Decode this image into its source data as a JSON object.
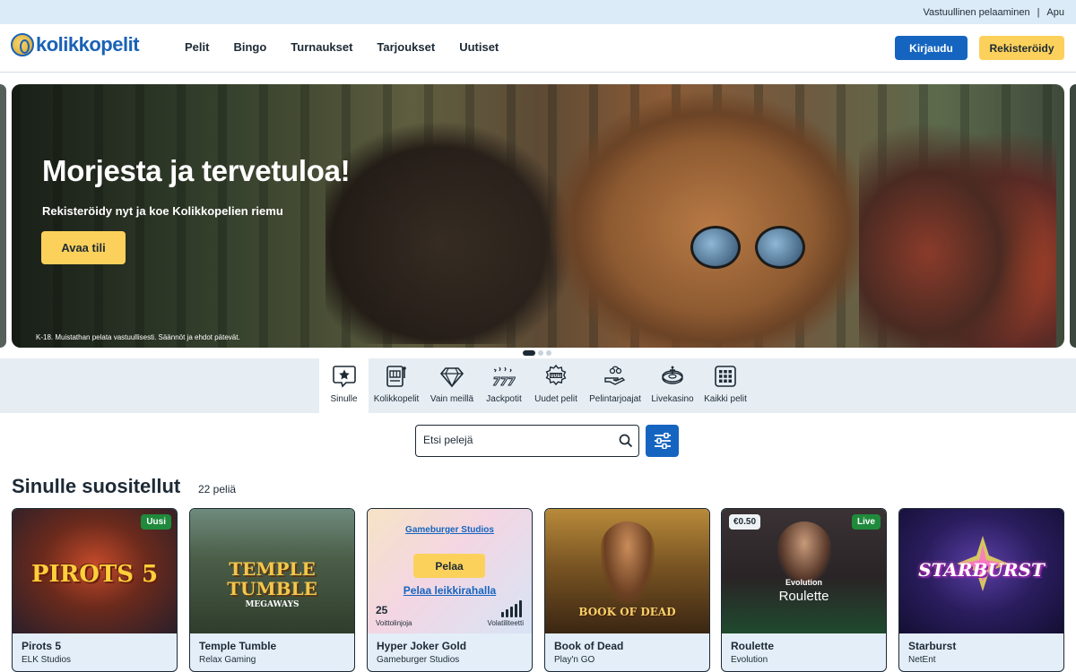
{
  "topbar": {
    "responsible": "Vastuullinen pelaaminen",
    "separator": "|",
    "help": "Apu"
  },
  "header": {
    "logo_text": "kolikkopelit",
    "nav": [
      "Pelit",
      "Bingo",
      "Turnaukset",
      "Tarjoukset",
      "Uutiset"
    ],
    "login": "Kirjaudu",
    "register": "Rekisteröidy"
  },
  "hero": {
    "title": "Morjesta ja tervetuloa!",
    "subtitle": "Rekisteröidy nyt ja koe Kolikkopelien riemu",
    "cta": "Avaa tili",
    "disclaimer": "K-18. Muistathan pelata vastuullisesti. Säännöt ja ehdot pätevät."
  },
  "categories": [
    {
      "label": "Sinulle",
      "icon": "star-speech-icon",
      "active": true
    },
    {
      "label": "Kolikkopelit",
      "icon": "slot-machine-icon"
    },
    {
      "label": "Vain meillä",
      "icon": "diamond-icon"
    },
    {
      "label": "Jackpotit",
      "icon": "jackpot-777-icon"
    },
    {
      "label": "Uudet pelit",
      "icon": "new-badge-icon"
    },
    {
      "label": "Pelintarjoajat",
      "icon": "provider-hand-icon"
    },
    {
      "label": "Livekasino",
      "icon": "roulette-wheel-icon"
    },
    {
      "label": "Kaikki pelit",
      "icon": "grid-icon"
    }
  ],
  "search": {
    "placeholder": "Etsi pelejä"
  },
  "section": {
    "title": "Sinulle suositellut",
    "count": "22 peliä"
  },
  "games": [
    {
      "name": "Pirots 5",
      "provider": "ELK Studios",
      "badge": "Uusi",
      "art": "PIROTS 5"
    },
    {
      "name": "Temple Tumble",
      "provider": "Relax Gaming",
      "art": "TEMPLE TUMBLE",
      "art_sub": "MEGAWAYS"
    },
    {
      "name": "Hyper Joker Gold",
      "provider": "Gameburger Studios",
      "hover": {
        "provider_link": "Gameburger Studios",
        "play": "Pelaa",
        "demo": "Pelaa leikkirahalla",
        "lines_value": "25",
        "lines_label": "Voittolinjoja",
        "volatility_label": "Volatiliteetti"
      }
    },
    {
      "name": "Book of Dead",
      "provider": "Play'n GO",
      "art": "BOOK OF DEAD"
    },
    {
      "name": "Roulette",
      "provider": "Evolution",
      "badge": "Live",
      "price": "€0.50",
      "art_brand": "Evolution",
      "art": "Roulette"
    },
    {
      "name": "Starburst",
      "provider": "NetEnt",
      "art": "STARBURST"
    }
  ],
  "colors": {
    "primary": "#1565c0",
    "accent": "#fcd15b",
    "text": "#1d2a35",
    "badge_green": "#1f8a3c",
    "category_bg": "#e6edf3"
  }
}
